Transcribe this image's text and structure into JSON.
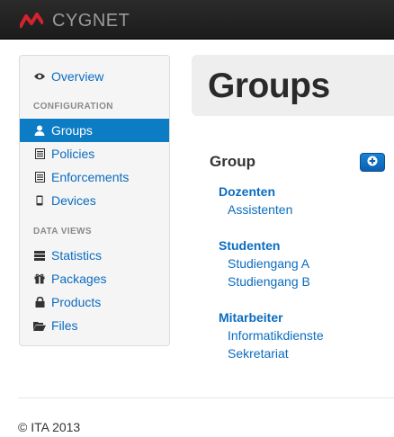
{
  "app": {
    "name": "CYGNET",
    "brand_color": "#d3232e"
  },
  "sidebar": {
    "overview": {
      "label": "Overview",
      "icon": "eye-icon"
    },
    "configuration_header": "CONFIGURATION",
    "configuration_items": [
      {
        "label": "Groups",
        "icon": "user-icon",
        "active": true
      },
      {
        "label": "Policies",
        "icon": "list-icon",
        "active": false
      },
      {
        "label": "Enforcements",
        "icon": "list-icon",
        "active": false
      },
      {
        "label": "Devices",
        "icon": "mobile-icon",
        "active": false
      }
    ],
    "dataviews_header": "DATA VIEWS",
    "dataviews_items": [
      {
        "label": "Statistics",
        "icon": "stack-icon"
      },
      {
        "label": "Packages",
        "icon": "gift-icon"
      },
      {
        "label": "Products",
        "icon": "lock-icon"
      },
      {
        "label": "Files",
        "icon": "folder-open-icon"
      }
    ]
  },
  "main": {
    "title": "Groups",
    "section_title": "Group",
    "add_button_icon": "plus-circle-icon",
    "groups": [
      {
        "name": "Dozenten",
        "children": [
          "Assistenten"
        ]
      },
      {
        "name": "Studenten",
        "children": [
          "Studiengang A",
          "Studiengang B"
        ]
      },
      {
        "name": "Mitarbeiter",
        "children": [
          "Informatikdienste",
          "Sekretariat"
        ]
      }
    ]
  },
  "footer": {
    "text": "© ITA 2013"
  },
  "colors": {
    "accent": "#0c7cc4",
    "link": "#0b6cbf",
    "navbar": "#1b1b1b"
  }
}
